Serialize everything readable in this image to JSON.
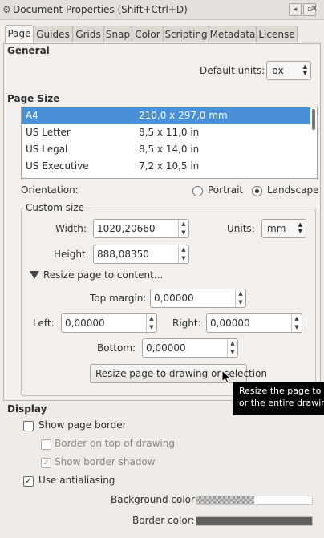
{
  "window": {
    "title": "Document Properties (Shift+Ctrl+D)"
  },
  "tabs": [
    "Page",
    "Guides",
    "Grids",
    "Snap",
    "Color",
    "Scripting",
    "Metadata",
    "License"
  ],
  "general": {
    "heading": "General",
    "default_units_label": "Default units:",
    "default_units_value": "px"
  },
  "page_size": {
    "heading": "Page Size",
    "rows": [
      {
        "name": "A4",
        "size": "210,0 x 297,0 mm"
      },
      {
        "name": "US Letter",
        "size": "8,5 x 11,0 in"
      },
      {
        "name": "US Legal",
        "size": "8,5 x 14,0 in"
      },
      {
        "name": "US Executive",
        "size": "7,2 x 10,5 in"
      }
    ]
  },
  "orientation": {
    "label": "Orientation:",
    "portrait": "Portrait",
    "landscape": "Landscape"
  },
  "custom_size": {
    "legend": "Custom size",
    "width_label": "Width:",
    "width_value": "1020,20660",
    "height_label": "Height:",
    "height_value": "888,08350",
    "units_label": "Units:",
    "units_value": "mm",
    "resize_expander": "Resize page to content...",
    "top_margin_label": "Top margin:",
    "top_margin_value": "0,00000",
    "left_label": "Left:",
    "left_value": "0,00000",
    "right_label": "Right:",
    "right_value": "0,00000",
    "bottom_label": "Bottom:",
    "bottom_value": "0,00000",
    "resize_button": "Resize page to drawing or selection"
  },
  "tooltip": {
    "line1": "Resize the page to fit",
    "line2": "or the entire drawing"
  },
  "display": {
    "heading": "Display",
    "show_page_border": "Show page border",
    "border_on_top": "Border on top of drawing",
    "show_border_shadow": "Show border shadow",
    "use_antialiasing": "Use antialiasing",
    "background_color_label": "Background color:",
    "border_color_label": "Border color:",
    "border_color": "#5f5f5f"
  }
}
